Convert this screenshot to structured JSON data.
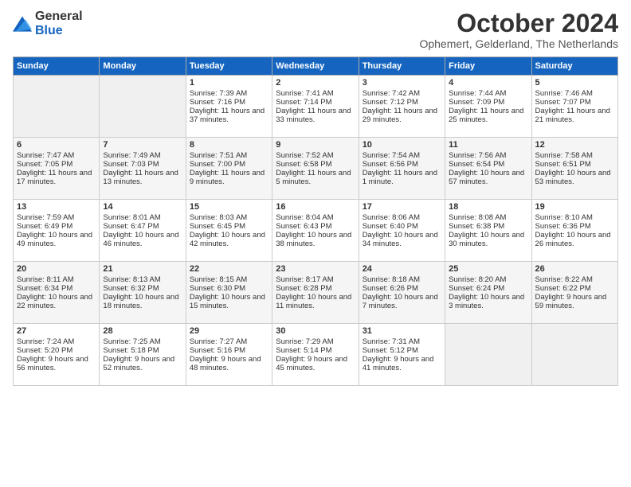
{
  "header": {
    "logo": {
      "text_general": "General",
      "text_blue": "Blue"
    },
    "month": "October 2024",
    "location": "Ophemert, Gelderland, The Netherlands"
  },
  "weekdays": [
    "Sunday",
    "Monday",
    "Tuesday",
    "Wednesday",
    "Thursday",
    "Friday",
    "Saturday"
  ],
  "weeks": [
    [
      {
        "day": "",
        "empty": true
      },
      {
        "day": "",
        "empty": true
      },
      {
        "day": "1",
        "sunrise": "Sunrise: 7:39 AM",
        "sunset": "Sunset: 7:16 PM",
        "daylight": "Daylight: 11 hours and 37 minutes."
      },
      {
        "day": "2",
        "sunrise": "Sunrise: 7:41 AM",
        "sunset": "Sunset: 7:14 PM",
        "daylight": "Daylight: 11 hours and 33 minutes."
      },
      {
        "day": "3",
        "sunrise": "Sunrise: 7:42 AM",
        "sunset": "Sunset: 7:12 PM",
        "daylight": "Daylight: 11 hours and 29 minutes."
      },
      {
        "day": "4",
        "sunrise": "Sunrise: 7:44 AM",
        "sunset": "Sunset: 7:09 PM",
        "daylight": "Daylight: 11 hours and 25 minutes."
      },
      {
        "day": "5",
        "sunrise": "Sunrise: 7:46 AM",
        "sunset": "Sunset: 7:07 PM",
        "daylight": "Daylight: 11 hours and 21 minutes."
      }
    ],
    [
      {
        "day": "6",
        "sunrise": "Sunrise: 7:47 AM",
        "sunset": "Sunset: 7:05 PM",
        "daylight": "Daylight: 11 hours and 17 minutes."
      },
      {
        "day": "7",
        "sunrise": "Sunrise: 7:49 AM",
        "sunset": "Sunset: 7:03 PM",
        "daylight": "Daylight: 11 hours and 13 minutes."
      },
      {
        "day": "8",
        "sunrise": "Sunrise: 7:51 AM",
        "sunset": "Sunset: 7:00 PM",
        "daylight": "Daylight: 11 hours and 9 minutes."
      },
      {
        "day": "9",
        "sunrise": "Sunrise: 7:52 AM",
        "sunset": "Sunset: 6:58 PM",
        "daylight": "Daylight: 11 hours and 5 minutes."
      },
      {
        "day": "10",
        "sunrise": "Sunrise: 7:54 AM",
        "sunset": "Sunset: 6:56 PM",
        "daylight": "Daylight: 11 hours and 1 minute."
      },
      {
        "day": "11",
        "sunrise": "Sunrise: 7:56 AM",
        "sunset": "Sunset: 6:54 PM",
        "daylight": "Daylight: 10 hours and 57 minutes."
      },
      {
        "day": "12",
        "sunrise": "Sunrise: 7:58 AM",
        "sunset": "Sunset: 6:51 PM",
        "daylight": "Daylight: 10 hours and 53 minutes."
      }
    ],
    [
      {
        "day": "13",
        "sunrise": "Sunrise: 7:59 AM",
        "sunset": "Sunset: 6:49 PM",
        "daylight": "Daylight: 10 hours and 49 minutes."
      },
      {
        "day": "14",
        "sunrise": "Sunrise: 8:01 AM",
        "sunset": "Sunset: 6:47 PM",
        "daylight": "Daylight: 10 hours and 46 minutes."
      },
      {
        "day": "15",
        "sunrise": "Sunrise: 8:03 AM",
        "sunset": "Sunset: 6:45 PM",
        "daylight": "Daylight: 10 hours and 42 minutes."
      },
      {
        "day": "16",
        "sunrise": "Sunrise: 8:04 AM",
        "sunset": "Sunset: 6:43 PM",
        "daylight": "Daylight: 10 hours and 38 minutes."
      },
      {
        "day": "17",
        "sunrise": "Sunrise: 8:06 AM",
        "sunset": "Sunset: 6:40 PM",
        "daylight": "Daylight: 10 hours and 34 minutes."
      },
      {
        "day": "18",
        "sunrise": "Sunrise: 8:08 AM",
        "sunset": "Sunset: 6:38 PM",
        "daylight": "Daylight: 10 hours and 30 minutes."
      },
      {
        "day": "19",
        "sunrise": "Sunrise: 8:10 AM",
        "sunset": "Sunset: 6:36 PM",
        "daylight": "Daylight: 10 hours and 26 minutes."
      }
    ],
    [
      {
        "day": "20",
        "sunrise": "Sunrise: 8:11 AM",
        "sunset": "Sunset: 6:34 PM",
        "daylight": "Daylight: 10 hours and 22 minutes."
      },
      {
        "day": "21",
        "sunrise": "Sunrise: 8:13 AM",
        "sunset": "Sunset: 6:32 PM",
        "daylight": "Daylight: 10 hours and 18 minutes."
      },
      {
        "day": "22",
        "sunrise": "Sunrise: 8:15 AM",
        "sunset": "Sunset: 6:30 PM",
        "daylight": "Daylight: 10 hours and 15 minutes."
      },
      {
        "day": "23",
        "sunrise": "Sunrise: 8:17 AM",
        "sunset": "Sunset: 6:28 PM",
        "daylight": "Daylight: 10 hours and 11 minutes."
      },
      {
        "day": "24",
        "sunrise": "Sunrise: 8:18 AM",
        "sunset": "Sunset: 6:26 PM",
        "daylight": "Daylight: 10 hours and 7 minutes."
      },
      {
        "day": "25",
        "sunrise": "Sunrise: 8:20 AM",
        "sunset": "Sunset: 6:24 PM",
        "daylight": "Daylight: 10 hours and 3 minutes."
      },
      {
        "day": "26",
        "sunrise": "Sunrise: 8:22 AM",
        "sunset": "Sunset: 6:22 PM",
        "daylight": "Daylight: 9 hours and 59 minutes."
      }
    ],
    [
      {
        "day": "27",
        "sunrise": "Sunrise: 7:24 AM",
        "sunset": "Sunset: 5:20 PM",
        "daylight": "Daylight: 9 hours and 56 minutes."
      },
      {
        "day": "28",
        "sunrise": "Sunrise: 7:25 AM",
        "sunset": "Sunset: 5:18 PM",
        "daylight": "Daylight: 9 hours and 52 minutes."
      },
      {
        "day": "29",
        "sunrise": "Sunrise: 7:27 AM",
        "sunset": "Sunset: 5:16 PM",
        "daylight": "Daylight: 9 hours and 48 minutes."
      },
      {
        "day": "30",
        "sunrise": "Sunrise: 7:29 AM",
        "sunset": "Sunset: 5:14 PM",
        "daylight": "Daylight: 9 hours and 45 minutes."
      },
      {
        "day": "31",
        "sunrise": "Sunrise: 7:31 AM",
        "sunset": "Sunset: 5:12 PM",
        "daylight": "Daylight: 9 hours and 41 minutes."
      },
      {
        "day": "",
        "empty": true
      },
      {
        "day": "",
        "empty": true
      }
    ]
  ]
}
